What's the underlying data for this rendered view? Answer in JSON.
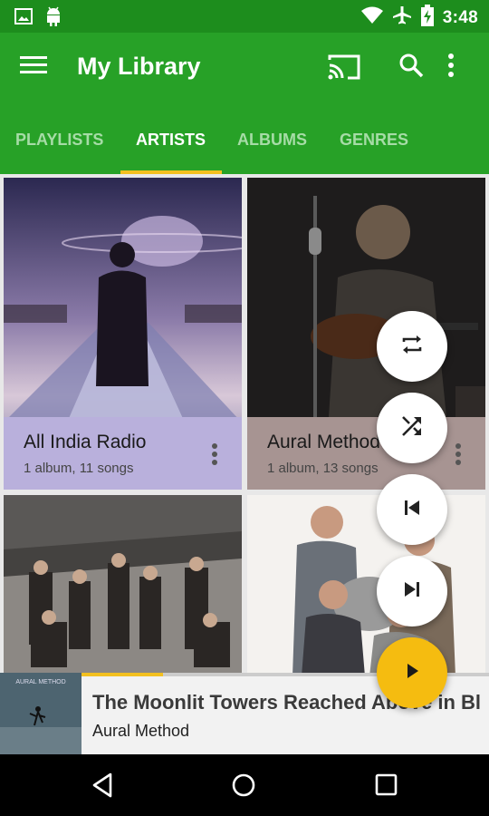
{
  "status_bar": {
    "time": "3:48",
    "icons": [
      "image-icon",
      "android-icon",
      "wifi-icon",
      "airplane-icon",
      "battery-charging-icon"
    ]
  },
  "app_bar": {
    "title": "My Library",
    "actions": [
      "menu-icon",
      "cast-icon",
      "search-icon",
      "more-vert-icon"
    ],
    "color": "#27a127",
    "status_color": "#1d8d1d"
  },
  "tabs": [
    {
      "label": "PLAYLISTS",
      "active": false
    },
    {
      "label": "ARTISTS",
      "active": true
    },
    {
      "label": "ALBUMS",
      "active": false
    },
    {
      "label": "GENRES",
      "active": false
    }
  ],
  "accent_color": "#f3c020",
  "artists": [
    {
      "name": "All India Radio",
      "meta": "1 album, 11 songs",
      "panel_color": "#b9b0dc"
    },
    {
      "name": "Aural Method",
      "meta": "1 album, 13 songs",
      "panel_color": "#a79492"
    },
    {
      "name": "",
      "meta": "",
      "panel_color": ""
    },
    {
      "name": "",
      "meta": "",
      "panel_color": ""
    }
  ],
  "fab_controls": [
    "repeat-icon",
    "shuffle-icon",
    "skip-previous-icon",
    "skip-next-icon",
    "play-icon"
  ],
  "now_playing": {
    "title": "The Moonlit Towers Reached Above in Bl…",
    "artist": "Aural Method",
    "album_art_text": "AURAL METHOD",
    "progress": 0.2
  },
  "nav_bar": [
    "back-icon",
    "home-icon",
    "recents-icon"
  ]
}
